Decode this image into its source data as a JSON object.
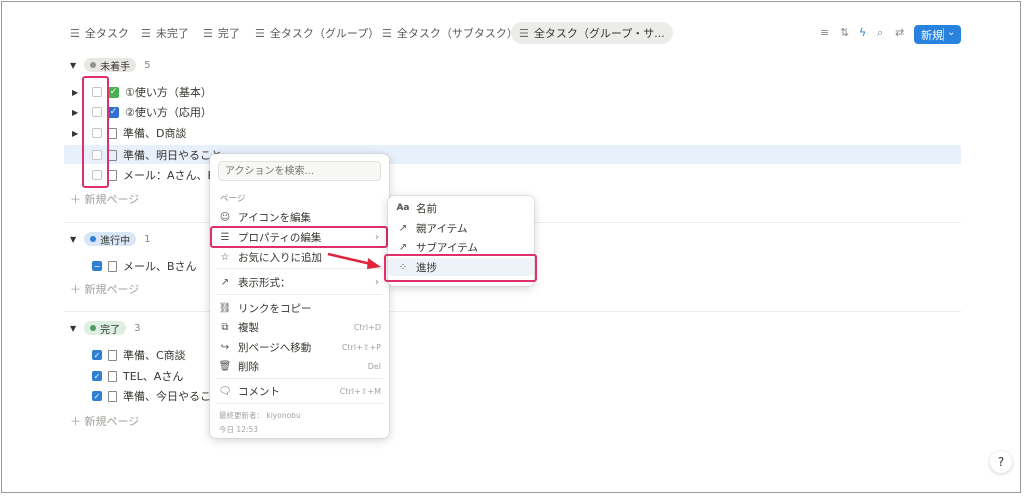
{
  "tabs": [
    {
      "label": "全タスク"
    },
    {
      "label": "未完了"
    },
    {
      "label": "完了"
    },
    {
      "label": "全タスク（グループ）"
    },
    {
      "label": "全タスク（サブタスク）"
    },
    {
      "label": "全タスク（グループ・サ..."
    }
  ],
  "toolbar": {
    "new_label": "新規"
  },
  "groups": {
    "todo": {
      "label": "未着手",
      "count": "5",
      "rows": [
        "①使い方（基本）",
        "②使い方（応用）",
        "準備、D商談",
        "準備、明日やること",
        "メール：Aさん、B"
      ],
      "add": "新規ページ"
    },
    "doing": {
      "label": "進行中",
      "count": "1",
      "rows": [
        "メール、Bさん"
      ],
      "add": "新規ページ"
    },
    "done": {
      "label": "完了",
      "count": "3",
      "rows": [
        "準備、C商談",
        "TEL、Aさん",
        "準備、今日やるこ"
      ],
      "add": "新規ページ"
    }
  },
  "context_menu": {
    "search_placeholder": "アクションを検索...",
    "section_label": "ページ",
    "items": {
      "edit_icon": "アイコンを編集",
      "edit_props": "プロパティの編集",
      "favorite": "お気に入りに追加",
      "display_format": "表示形式：",
      "copy_link": "リンクをコピー",
      "duplicate": "複製",
      "duplicate_sc": "Ctrl+D",
      "move": "別ページへ移動",
      "move_sc": "Ctrl+⇧+P",
      "delete": "削除",
      "delete_sc": "Del",
      "comment": "コメント",
      "comment_sc": "Ctrl+⇧+M"
    },
    "footer_editor": "最終更新者： kiyonobu",
    "footer_time": "今日 12:53"
  },
  "submenu": {
    "items": {
      "name": "名前",
      "parent": "親アイテム",
      "sub": "サブアイテム",
      "progress": "進捗"
    },
    "name_icon_text": "Aa"
  },
  "colors": {
    "accent": "#2783de",
    "highlight": "#e0306c",
    "row_selected": "#e7f0fb",
    "check_green": "#4caf50",
    "check_blue": "#2f6fd0"
  }
}
